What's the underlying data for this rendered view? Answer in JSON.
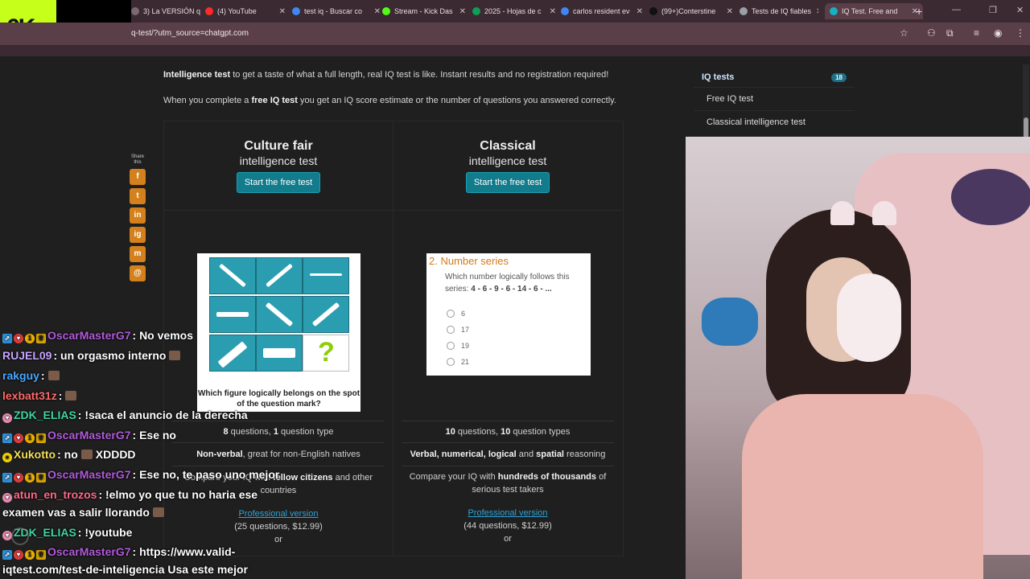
{
  "browser": {
    "tabs": [
      {
        "label": "3) La VERSIÓN q",
        "color": "#7a6a70"
      },
      {
        "label": "(4) YouTube",
        "color": "#ff2a2a"
      },
      {
        "label": "test iq - Buscar co",
        "color": "#4285f4"
      },
      {
        "label": "Stream - Kick Das",
        "color": "#53fc18"
      },
      {
        "label": "2025 - Hojas de c",
        "color": "#0f9d58"
      },
      {
        "label": "carlos resident ev",
        "color": "#4285f4"
      },
      {
        "label": "(99+)Conterstine",
        "color": "#111111"
      },
      {
        "label": "Tests de IQ fiables",
        "color": "#9aa0a6"
      },
      {
        "label": "IQ Test. Free and",
        "color": "#17b0c4"
      }
    ],
    "new_tab": "+",
    "url": "q-test/?utm_source=chatgpt.com"
  },
  "logo": {
    "text": "6K"
  },
  "page": {
    "intro_bold": "Intelligence test",
    "intro_rest": " to get a taste of what a full length, real IQ test is like. Instant results and no registration required!",
    "intro2_a": "When you complete a ",
    "intro2_bold": "free IQ test",
    "intro2_b": " you get an IQ score estimate or the number of questions you answered correctly.",
    "share_label": "Share this",
    "share_icons": [
      "f",
      "t",
      "in",
      "ig",
      "m",
      "@"
    ],
    "sidebar": {
      "head": "IQ tests",
      "badge": "18",
      "items": [
        "Free IQ test",
        "Classical intelligence test"
      ]
    },
    "left": {
      "title": "Culture fair",
      "subtitle": "intelligence test",
      "button": "Start the free test",
      "figure_caption": "Which figure logically belongs on the spot of the question mark?",
      "figure_q": "?",
      "f1_a": "8",
      "f1_b": " questions, ",
      "f1_c": "1",
      "f1_d": " question type",
      "f2_bold": "Non-verbal",
      "f2_rest": ", great for non-English natives",
      "f3_a": "Compare your IQ with ",
      "f3_bold": "fellow citizens",
      "f3_b": " and other countries",
      "pro": "Professional version",
      "pro_detail": "(25 questions, $12.99)",
      "or": "or"
    },
    "right": {
      "title": "Classical",
      "subtitle": "intelligence test",
      "button": "Start the free test",
      "figure_title": "2. Number series",
      "figure_q_a": "Which number logically follows this series: ",
      "figure_q_bold": "4 - 6 - 9 - 6 - 14 - 6 - ...",
      "options": [
        "6",
        "17",
        "19",
        "21"
      ],
      "f1_a": "10",
      "f1_b": " questions, ",
      "f1_c": "10",
      "f1_d": " question types",
      "f2_bold1": "Verbal, numerical, logical",
      "f2_mid": " and ",
      "f2_bold2": "spatial",
      "f2_rest": " reasoning",
      "f3_a": "Compare your IQ with ",
      "f3_bold": "hundreds of thousands",
      "f3_b": " of serious test takers",
      "pro": "Professional version",
      "pro_detail": "(44 questions, $12.99)",
      "or": "or"
    }
  },
  "chat": [
    {
      "user": "OscarMasterG7",
      "color": "#b15bd9",
      "badges": [
        "blue",
        "red",
        "gold",
        "crown"
      ],
      "text": ": No vemos"
    },
    {
      "user": "RUJEL09",
      "color": "#c7a4ff",
      "badges": [],
      "text": ": un orgasmo interno",
      "emote": true
    },
    {
      "user": "rakguy",
      "color": "#4aa8ff",
      "badges": [],
      "text": ":",
      "emote": true
    },
    {
      "user": "lexbatt31z",
      "color": "#ff6a6a",
      "badges": [],
      "text": ":",
      "emote": true
    },
    {
      "user": "ZDK_ELIAS",
      "color": "#3fd6a6",
      "badges": [
        "pink"
      ],
      "text": ": !saca el anuncio de la derecha"
    },
    {
      "user": "OscarMasterG7",
      "color": "#b15bd9",
      "badges": [
        "blue",
        "red",
        "gold",
        "crown"
      ],
      "text": ": Ese no"
    },
    {
      "user": "Xukotto",
      "color": "#f2e05a",
      "badges": [
        "yellow"
      ],
      "text": ": no",
      "emote_mid": true,
      "text2": "XDDDD"
    },
    {
      "user": "OscarMasterG7",
      "color": "#b15bd9",
      "badges": [
        "blue",
        "red",
        "gold",
        "crown"
      ],
      "text": ": Ese no, te paso uno mejor"
    },
    {
      "user": "atun_en_trozos",
      "color": "#ff6a8a",
      "badges": [
        "pink"
      ],
      "text": ": !elmo yo que tu no haria ese"
    },
    {
      "user": "",
      "color": "#ffffff",
      "badges": [],
      "text": "examen vas a salir llorando",
      "emote": true
    },
    {
      "user": "ZDK_ELIAS",
      "color": "#3fd6a6",
      "badges": [
        "pink"
      ],
      "text": ": !youtube"
    },
    {
      "user": "OscarMasterG7",
      "color": "#b15bd9",
      "badges": [
        "blue",
        "red",
        "gold",
        "crown"
      ],
      "text": ": https://www.valid-"
    },
    {
      "user": "",
      "color": "#ffffff",
      "badges": [],
      "text": "iqtest.com/test-de-inteligencia Usa este mejor"
    }
  ]
}
